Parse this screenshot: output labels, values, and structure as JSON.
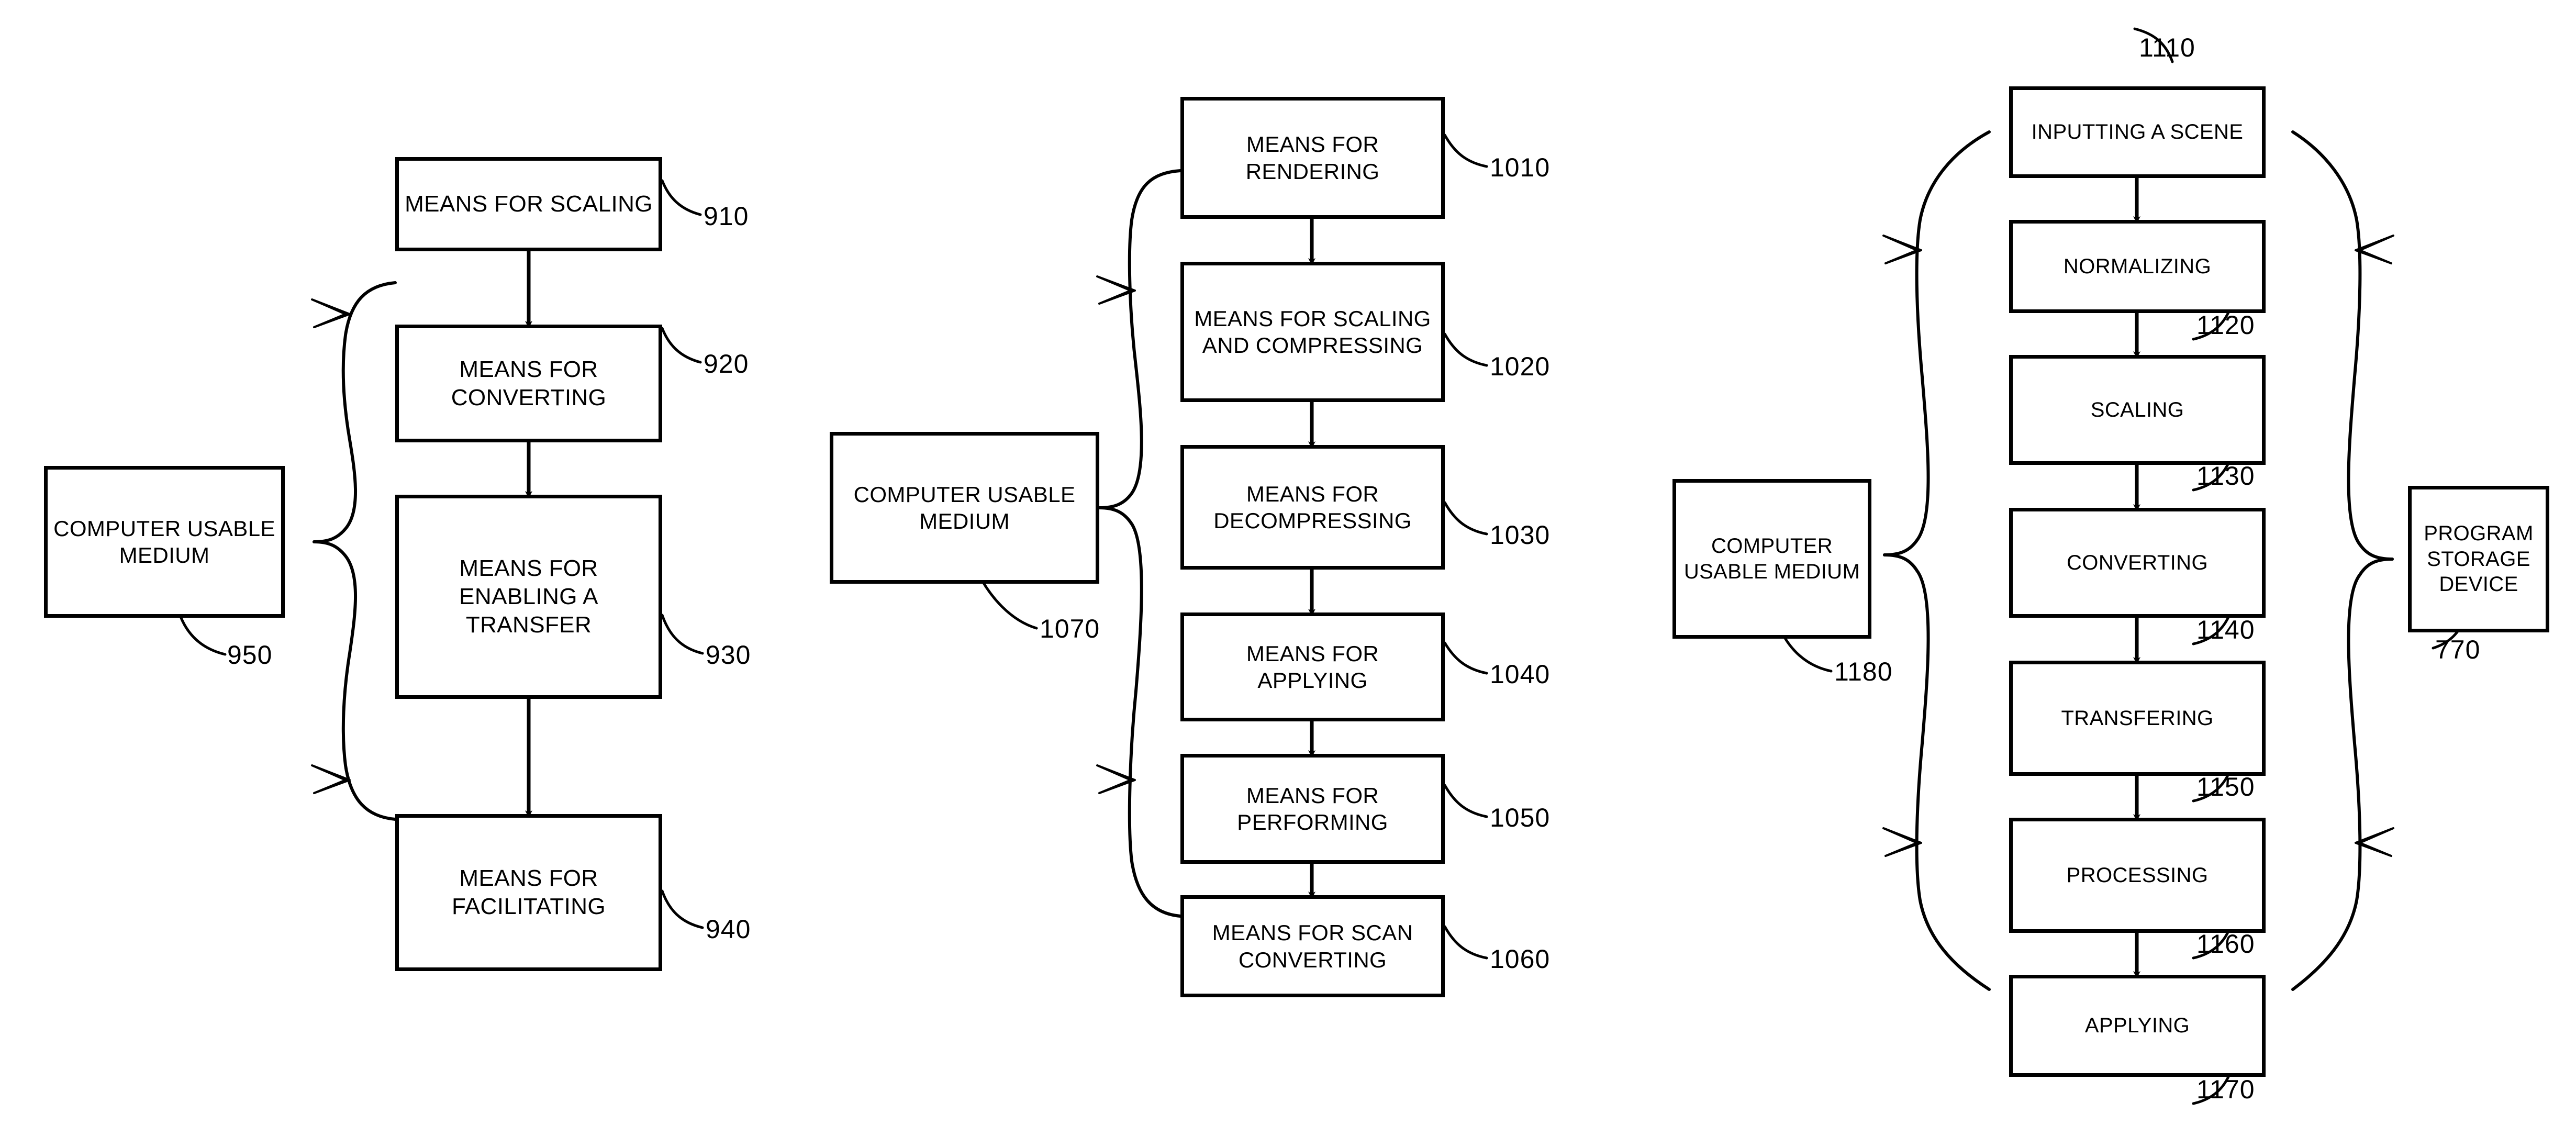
{
  "figure": {
    "kind": "patent-flowchart-sheet",
    "groups": [
      {
        "id": "group-950",
        "medium": {
          "label": "COMPUTER USABLE\nMEDIUM",
          "ref": "950"
        },
        "steps": [
          {
            "label": "MEANS FOR SCALING",
            "ref": "910"
          },
          {
            "label": "MEANS FOR\nCONVERTING",
            "ref": "920"
          },
          {
            "label": "MEANS FOR\nENABLING A\nTRANSFER",
            "ref": "930"
          },
          {
            "label": "MEANS FOR\nFACILITATING",
            "ref": "940"
          }
        ]
      },
      {
        "id": "group-1070",
        "medium": {
          "label": "COMPUTER USABLE\nMEDIUM",
          "ref": "1070"
        },
        "steps": [
          {
            "label": "MEANS FOR\nRENDERING",
            "ref": "1010"
          },
          {
            "label": "MEANS FOR SCALING\nAND COMPRESSING",
            "ref": "1020"
          },
          {
            "label": "MEANS FOR\nDECOMPRESSING",
            "ref": "1030"
          },
          {
            "label": "MEANS FOR APPLYING",
            "ref": "1040"
          },
          {
            "label": "MEANS FOR\nPERFORMING",
            "ref": "1050"
          },
          {
            "label": "MEANS FOR SCAN\nCONVERTING",
            "ref": "1060"
          }
        ]
      },
      {
        "id": "group-1180",
        "medium": {
          "label": "COMPUTER\nUSABLE MEDIUM",
          "ref": "1180"
        },
        "device": {
          "label": "PROGRAM\nSTORAGE\nDEVICE",
          "ref": "770"
        },
        "steps": [
          {
            "label": "INPUTTING A SCENE",
            "ref": "1110"
          },
          {
            "label": "NORMALIZING",
            "ref": "1120"
          },
          {
            "label": "SCALING",
            "ref": "1130"
          },
          {
            "label": "CONVERTING",
            "ref": "1140"
          },
          {
            "label": "TRANSFERING",
            "ref": "1150"
          },
          {
            "label": "PROCESSING",
            "ref": "1160"
          },
          {
            "label": "APPLYING",
            "ref": "1170"
          }
        ]
      }
    ]
  }
}
